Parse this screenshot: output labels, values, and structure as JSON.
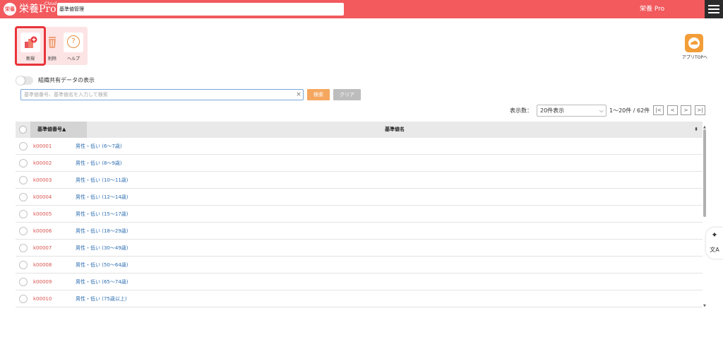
{
  "header": {
    "logo_mark": "栄養",
    "logo_text": "栄養Pro",
    "logo_sub": "Cloud",
    "screen_title": "基準値管理",
    "user_name": "栄養 Pro",
    "brand_color": "#f25a5e"
  },
  "toolbar": {
    "new_label": "新規",
    "delete_label": "削除",
    "help_label": "ヘルプ",
    "help_glyph": "?"
  },
  "app_top": {
    "label": "アプリTOPへ"
  },
  "toggle": {
    "label": "組織共有データの表示",
    "on": false
  },
  "search": {
    "placeholder": "基準値番号、基準値名を入力して検索",
    "value": "",
    "clear_glyph": "×",
    "search_label": "検索",
    "clear_label": "クリア"
  },
  "pagination": {
    "per_page_label": "表示数：",
    "per_page_value": "20件表示",
    "range_text": "1〜20件 / 62件",
    "first": "|<",
    "prev": "<",
    "next": ">",
    "last": ">|"
  },
  "table": {
    "col_code": "基準値番号▲",
    "col_name": "基準値名",
    "name_sort": "⬍",
    "rows": [
      {
        "code": "k00001",
        "name": "男性・低い (6〜7歳)"
      },
      {
        "code": "k00002",
        "name": "男性・低い (8〜9歳)"
      },
      {
        "code": "k00003",
        "name": "男性・低い (10〜11歳)"
      },
      {
        "code": "k00004",
        "name": "男性・低い (12〜14歳)"
      },
      {
        "code": "k00005",
        "name": "男性・低い (15〜17歳)"
      },
      {
        "code": "k00006",
        "name": "男性・低い (18〜29歳)"
      },
      {
        "code": "k00007",
        "name": "男性・低い (30〜49歳)"
      },
      {
        "code": "k00008",
        "name": "男性・低い (50〜64歳)"
      },
      {
        "code": "k00009",
        "name": "男性・低い (65〜74歳)"
      },
      {
        "code": "k00010",
        "name": "男性・低い (75歳以上)"
      }
    ]
  },
  "side_tools": {
    "sparkle_glyph": "✦",
    "translate_glyph": "文A"
  }
}
